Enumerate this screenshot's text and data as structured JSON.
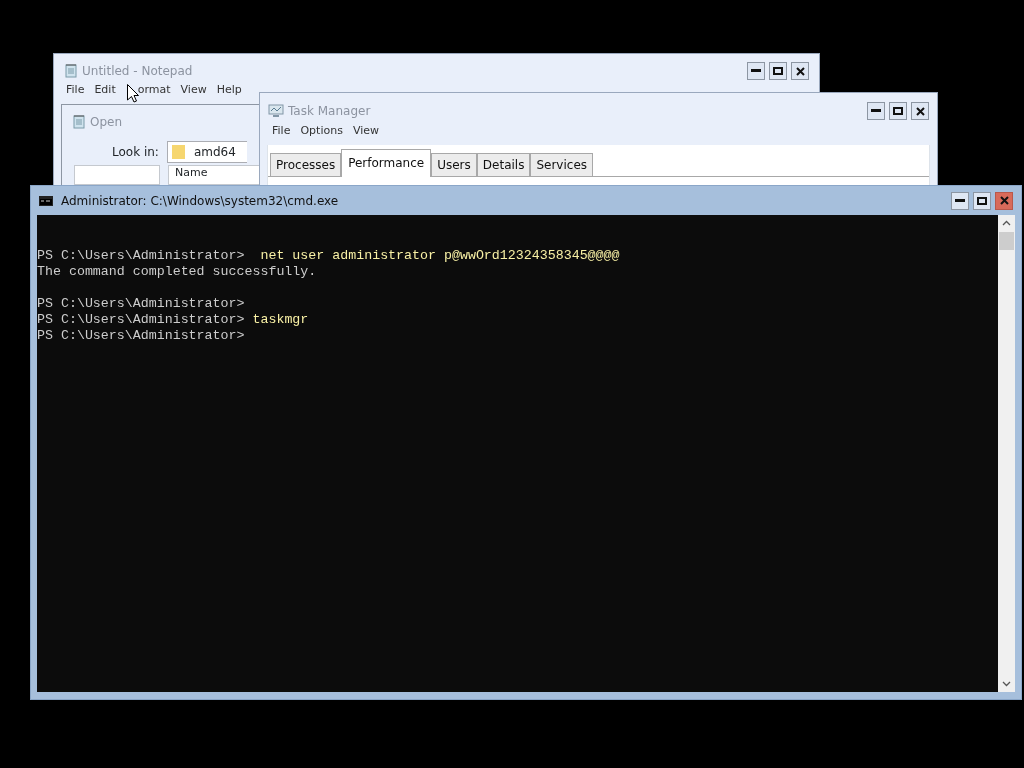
{
  "notepad": {
    "title": "Untitled - Notepad",
    "menu": [
      "File",
      "Edit",
      "ormat",
      "View",
      "Help"
    ]
  },
  "open_dialog": {
    "title": "Open",
    "look_in_label": "Look in:",
    "folder": "amd64",
    "column_header": "Name"
  },
  "task_manager": {
    "title": "Task Manager",
    "menu": [
      "File",
      "Options",
      "View"
    ],
    "tabs": [
      {
        "label": "Processes",
        "selected": false
      },
      {
        "label": "Performance",
        "selected": true
      },
      {
        "label": "Users",
        "selected": false
      },
      {
        "label": "Details",
        "selected": false
      },
      {
        "label": "Services",
        "selected": false
      }
    ]
  },
  "console": {
    "title": "Administrator: C:\\Windows\\system32\\cmd.exe",
    "lines": [
      {
        "kind": "blank"
      },
      {
        "kind": "command",
        "prompt": "PS C:\\Users\\Administrator>",
        "command": " net user administrator p@wwOrd12324358345@@@@"
      },
      {
        "kind": "output",
        "text": "The command completed successfully."
      },
      {
        "kind": "blank"
      },
      {
        "kind": "command",
        "prompt": "PS C:\\Users\\Administrator>"
      },
      {
        "kind": "command",
        "prompt": "PS C:\\Users\\Administrator>",
        "command": "taskmgr"
      },
      {
        "kind": "command",
        "prompt": "PS C:\\Users\\Administrator>"
      }
    ]
  }
}
